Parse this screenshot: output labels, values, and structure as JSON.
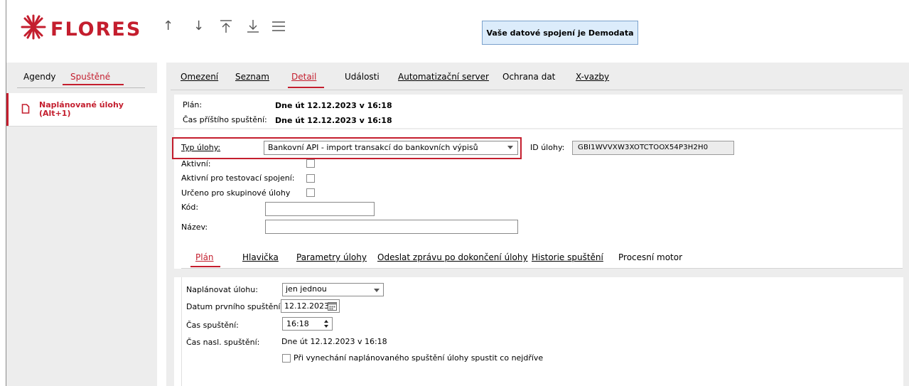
{
  "header": {
    "brand": "FLORES",
    "toolbar_icons": [
      "arrow-up-icon",
      "arrow-down-icon",
      "arrow-to-top-icon",
      "arrow-to-bottom-icon",
      "menu-icon"
    ],
    "connection_badge": "Vaše datové spojení je Demodata"
  },
  "sidebar": {
    "tabs": [
      {
        "label": "Agendy",
        "active": false
      },
      {
        "label": "Spuštěné",
        "active": true
      }
    ],
    "items": [
      {
        "label": "Naplánované úlohy\n(Alt+1)",
        "icon": "document-icon"
      }
    ]
  },
  "main": {
    "tabs": [
      {
        "label": "Omezení",
        "active": false
      },
      {
        "label": "Seznam",
        "active": false
      },
      {
        "label": "Detail",
        "active": true
      },
      {
        "label": "Události",
        "active": false
      },
      {
        "label": "Automatizační server",
        "active": false
      },
      {
        "label": "Ochrana dat",
        "active": false
      },
      {
        "label": "X-vazby",
        "active": false
      }
    ],
    "plan_label": "Plán:",
    "plan_value": "Dne út 12.12.2023 v 16:18",
    "next_run_label": "Čas příštího spuštění:",
    "next_run_value": "Dne út 12.12.2023 v 16:18",
    "task_type_label": "Typ úlohy:",
    "task_type_value": "Bankovní API - import transakcí do bankovních výpisů",
    "task_id_label": "ID úlohy:",
    "task_id_value": "GBI1WVVXW3XOTCTOOX54P3H2H0",
    "active_label": "Aktivní:",
    "active_test_label": "Aktivní pro testovací spojení:",
    "group_label": "Určeno pro skupinové úlohy",
    "code_label": "Kód:",
    "code_value": "",
    "name_label": "Název:",
    "name_value": ""
  },
  "subtabs": [
    {
      "label": "Plán",
      "active": true
    },
    {
      "label": "Hlavička",
      "active": false
    },
    {
      "label": "Parametry úlohy",
      "active": false
    },
    {
      "label": "Odeslat zprávu po dokončení úlohy",
      "active": false
    },
    {
      "label": "Historie spuštění",
      "active": false
    },
    {
      "label": "Procesní motor",
      "active": false
    }
  ],
  "schedule": {
    "schedule_label": "Naplánovat úlohu:",
    "schedule_value": "jen jednou",
    "first_run_label": "Datum prvního spuštění:",
    "first_run_value": "12.12.2023",
    "run_time_label": "Čas spuštění:",
    "run_time_value": "16:18",
    "next_label": "Čas nasl. spuštění:",
    "next_value": "Dne út 12.12.2023 v 16:18",
    "skip_checkbox_label": "Při vynechání naplánovaného spuštění úlohy spustit co nejdříve"
  },
  "colors": {
    "accent": "#c41e2e",
    "badge_bg": "#dcecfb",
    "panel_bg": "#ededed"
  }
}
